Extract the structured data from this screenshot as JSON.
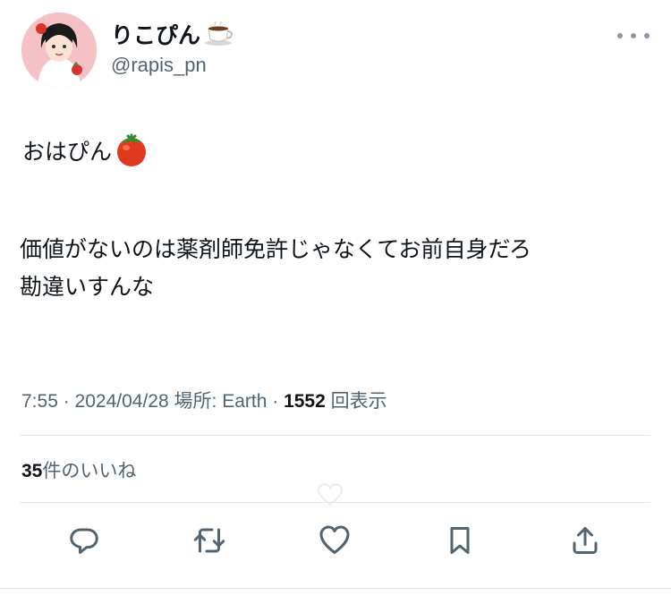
{
  "author": {
    "display_name": "りこぴん",
    "handle": "@rapis_pn"
  },
  "tweet": {
    "greeting": "おはぴん",
    "body_line1": "価値がないのは薬剤師免許じゃなくてお前自身だろ",
    "body_line2": "勘違いすんな"
  },
  "meta": {
    "time": "7:55",
    "date": "2024/04/28",
    "location_label": "場所:",
    "location": "Earth",
    "views": "1552",
    "views_label": "回表示"
  },
  "likes": {
    "count": "35",
    "label": "件のいいね"
  },
  "icons": [
    "avatar",
    "coffee-icon",
    "more-icon",
    "tomato-icon",
    "reply-icon",
    "retweet-icon",
    "like-icon",
    "bookmark-icon",
    "share-icon"
  ]
}
